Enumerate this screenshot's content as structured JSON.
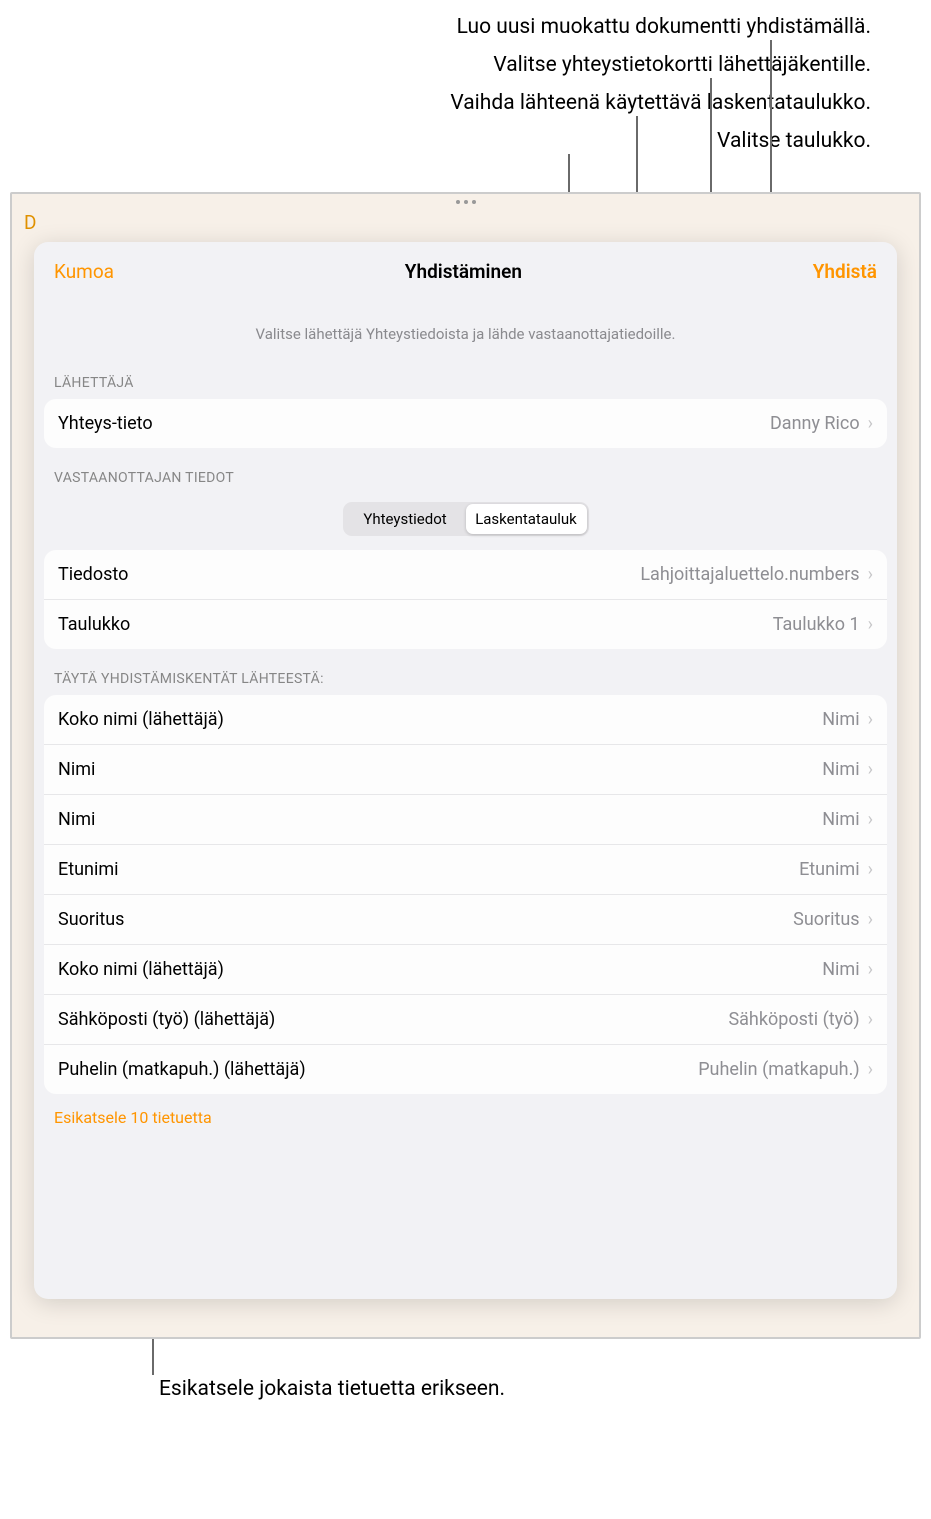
{
  "callouts": {
    "c1": "Luo uusi muokattu dokumentti yhdistämällä.",
    "c2": "Valitse yhteystietokortti lähettäjäkentille.",
    "c3": "Vaihda lähteenä käytettävä laskentataulukko.",
    "c4": "Valitse taulukko.",
    "c5": "Esikatsele jokaista tietuetta erikseen."
  },
  "modal": {
    "cancel": "Kumoa",
    "title": "Yhdistäminen",
    "action": "Yhdistä",
    "subtitle": "Valitse lähettäjä Yhteystiedoista ja lähde vastaanottajatiedoille."
  },
  "sender": {
    "section": "LÄHETTÄJÄ",
    "label": "Yhteys-tieto",
    "value": "Danny Rico"
  },
  "recipient": {
    "section": "VASTAANOTTAJAN TIEDOT",
    "seg1": "Yhteystiedot",
    "seg2": "Laskentatauluk"
  },
  "file": {
    "label": "Tiedosto",
    "value": "Lahjoittajaluettelo.numbers"
  },
  "table": {
    "label": "Taulukko",
    "value": "Taulukko 1"
  },
  "fieldsSection": "TÄYTÄ YHDISTÄMISKENTÄT LÄHTEESTÄ:",
  "fields": [
    {
      "label": "Koko nimi (lähettäjä)",
      "value": "Nimi"
    },
    {
      "label": "Nimi",
      "value": "Nimi"
    },
    {
      "label": "Nimi",
      "value": "Nimi"
    },
    {
      "label": "Etunimi",
      "value": "Etunimi"
    },
    {
      "label": "Suoritus",
      "value": "Suoritus"
    },
    {
      "label": "Koko nimi (lähettäjä)",
      "value": "Nimi"
    },
    {
      "label": "Sähköposti (työ) (lähettäjä)",
      "value": "Sähköposti (työ)"
    },
    {
      "label": "Puhelin (matkapuh.) (lähettäjä)",
      "value": "Puhelin (matkapuh.)"
    }
  ],
  "preview": "Esikatsele 10 tietuetta"
}
